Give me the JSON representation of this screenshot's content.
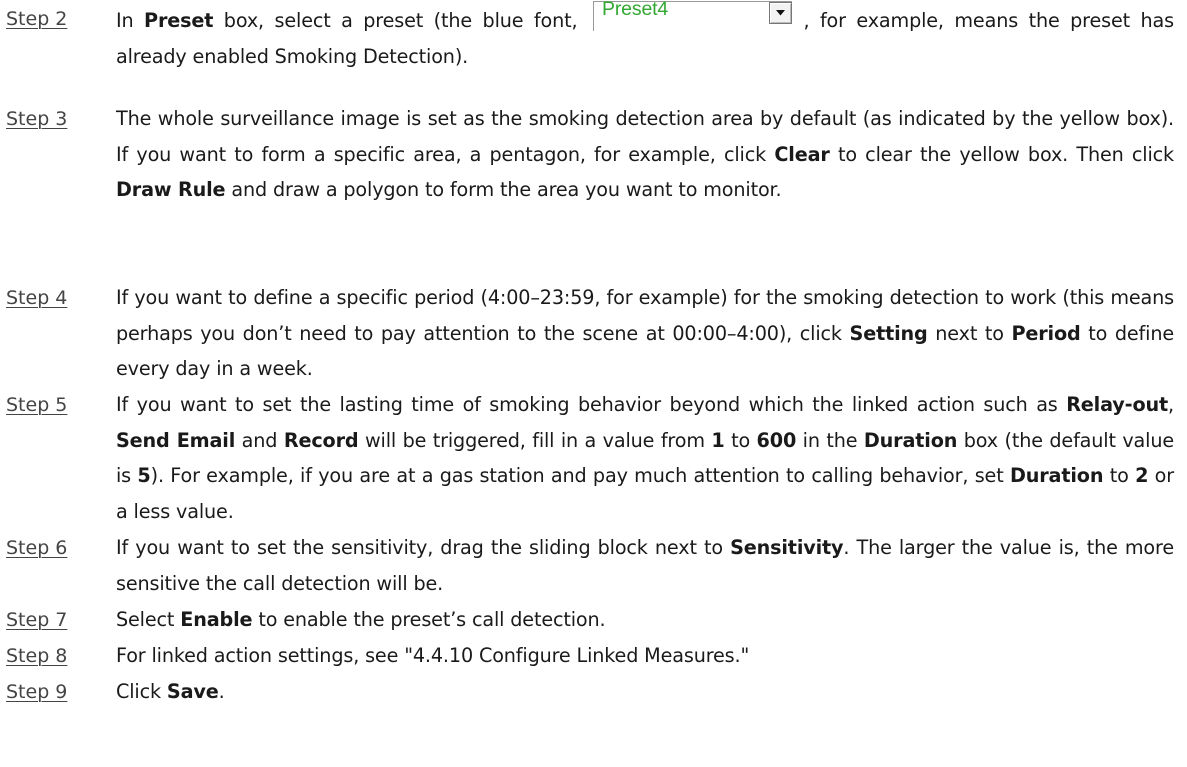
{
  "steps": [
    {
      "label": "Step 2",
      "parts": [
        {
          "t": "In "
        },
        {
          "b": "Preset"
        },
        {
          "t": " box, select a preset (the blue font, "
        },
        {
          "widget": true
        },
        {
          "t": ", for example, means the preset has already enabled Smoking Detection)."
        }
      ]
    },
    {
      "label": "Step 3",
      "parts": [
        {
          "t": "The whole surveillance image is set as the smoking detection area by default (as indicated by the yellow box). If you want to form a specific area, a pentagon, for example, click "
        },
        {
          "b": "Clear"
        },
        {
          "t": " to clear the yellow box. Then click "
        },
        {
          "b": "Draw Rule"
        },
        {
          "t": " and draw a polygon to form the area you want to monitor."
        }
      ]
    },
    {
      "label": "Step 4",
      "parts": [
        {
          "t": "If you want to define a specific period (4:00–23:59, for example) for the smoking detection to work (this means perhaps you don’t need to pay attention to the scene at 00:00–4:00), click "
        },
        {
          "b": "Setting"
        },
        {
          "t": " next to "
        },
        {
          "b": "Period"
        },
        {
          "t": " to define every day in a week."
        }
      ]
    },
    {
      "label": "Step 5",
      "parts": [
        {
          "t": "If you want to set the lasting time of smoking behavior beyond which the linked action such as "
        },
        {
          "b": "Relay-out"
        },
        {
          "t": ", "
        },
        {
          "b": "Send Email"
        },
        {
          "t": " and "
        },
        {
          "b": "Record"
        },
        {
          "t": " will be triggered, fill in a value from "
        },
        {
          "b": "1"
        },
        {
          "t": " to "
        },
        {
          "b": "600"
        },
        {
          "t": " in the "
        },
        {
          "b": "Duration"
        },
        {
          "t": " box (the default value is "
        },
        {
          "b": "5"
        },
        {
          "t": "). For example, if you are at a gas station and pay much attention to calling behavior, set "
        },
        {
          "b": "Duration"
        },
        {
          "t": " to "
        },
        {
          "b": "2"
        },
        {
          "t": " or a less value."
        }
      ]
    },
    {
      "label": "Step 6",
      "parts": [
        {
          "t": "If you want to set the sensitivity, drag the sliding block next to "
        },
        {
          "b": "Sensitivity"
        },
        {
          "t": ". The larger the value is, the more sensitive the call detection will be."
        }
      ]
    },
    {
      "label": "Step 7",
      "parts": [
        {
          "t": "Select "
        },
        {
          "b": "Enable"
        },
        {
          "t": " to enable the preset’s call detection."
        }
      ]
    },
    {
      "label": "Step 8",
      "parts": [
        {
          "t": "For linked action settings, see \"4.4.10 Configure Linked Measures.\""
        }
      ]
    },
    {
      "label": "Step 9",
      "parts": [
        {
          "t": "Click "
        },
        {
          "b": "Save"
        },
        {
          "t": "."
        }
      ]
    }
  ],
  "preset_widget": {
    "value": "Preset4",
    "text_color": "#32a832",
    "button_icon": "chevron-down-icon"
  }
}
